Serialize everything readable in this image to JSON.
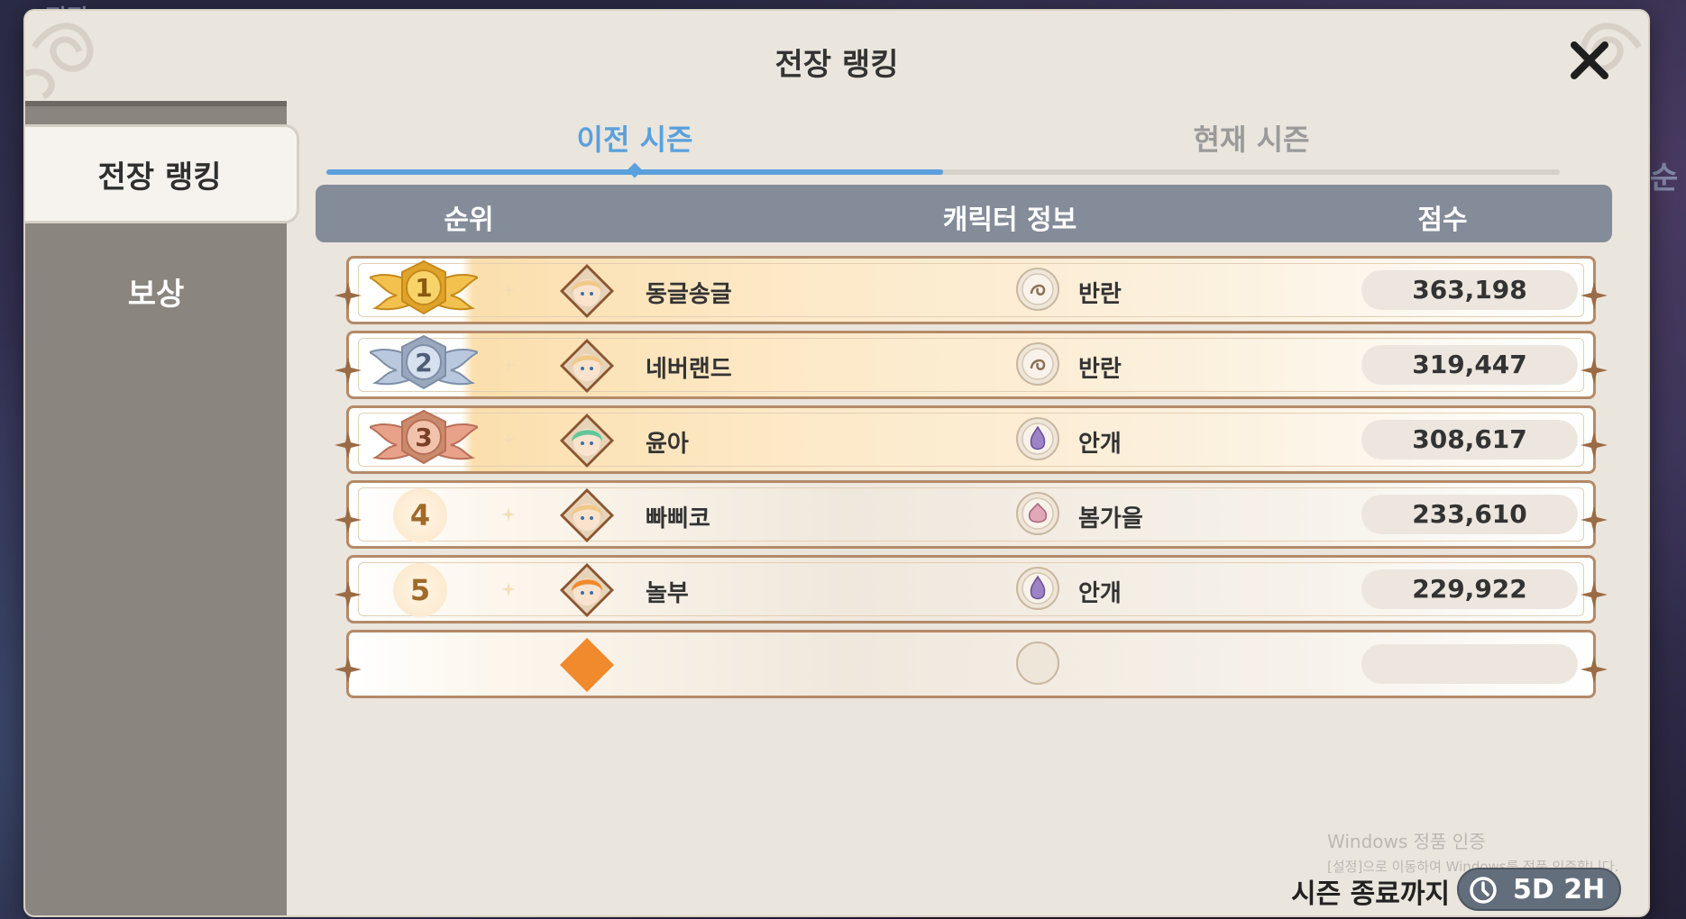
{
  "modal": {
    "title": "전장 랭킹"
  },
  "sidebar": {
    "items": [
      {
        "label": "전장 랭킹",
        "active": true
      },
      {
        "label": "보상",
        "active": false
      }
    ]
  },
  "tabs": [
    {
      "label": "이전 시즌",
      "active": true
    },
    {
      "label": "현재 시즌",
      "active": false
    }
  ],
  "table": {
    "headers": {
      "rank": "순위",
      "character": "캐릭터 정보",
      "score": "점수"
    },
    "rows": [
      {
        "rank": "1",
        "medal": "gold",
        "character": "동글송글",
        "guild": "반란",
        "guild_icon": "rebel-emblem",
        "score": "363,198"
      },
      {
        "rank": "2",
        "medal": "silver",
        "character": "네버랜드",
        "guild": "반란",
        "guild_icon": "rebel-emblem",
        "score": "319,447"
      },
      {
        "rank": "3",
        "medal": "bronze",
        "character": "윤아",
        "guild": "안개",
        "guild_icon": "mist-emblem",
        "score": "308,617"
      },
      {
        "rank": "4",
        "medal": "",
        "character": "빠삐코",
        "guild": "봄가을",
        "guild_icon": "season-emblem",
        "score": "233,610"
      },
      {
        "rank": "5",
        "medal": "",
        "character": "놀부",
        "guild": "안개",
        "guild_icon": "mist-emblem",
        "score": "229,922"
      }
    ]
  },
  "footer": {
    "season_end_label": "시즌 종료까지",
    "timer": "5D 2H"
  },
  "watermark": {
    "line1": "Windows 정품 인증",
    "line2": "[설정]으로 이동하여 Windows를 정품 인증합니다."
  },
  "background": {
    "text_top": "집집",
    "text_right": "순"
  },
  "colors": {
    "accent_tab": "#5aa0dc",
    "header_bar": "#848c99",
    "sidebar": "#8b857f",
    "panel": "#eae5dd"
  }
}
